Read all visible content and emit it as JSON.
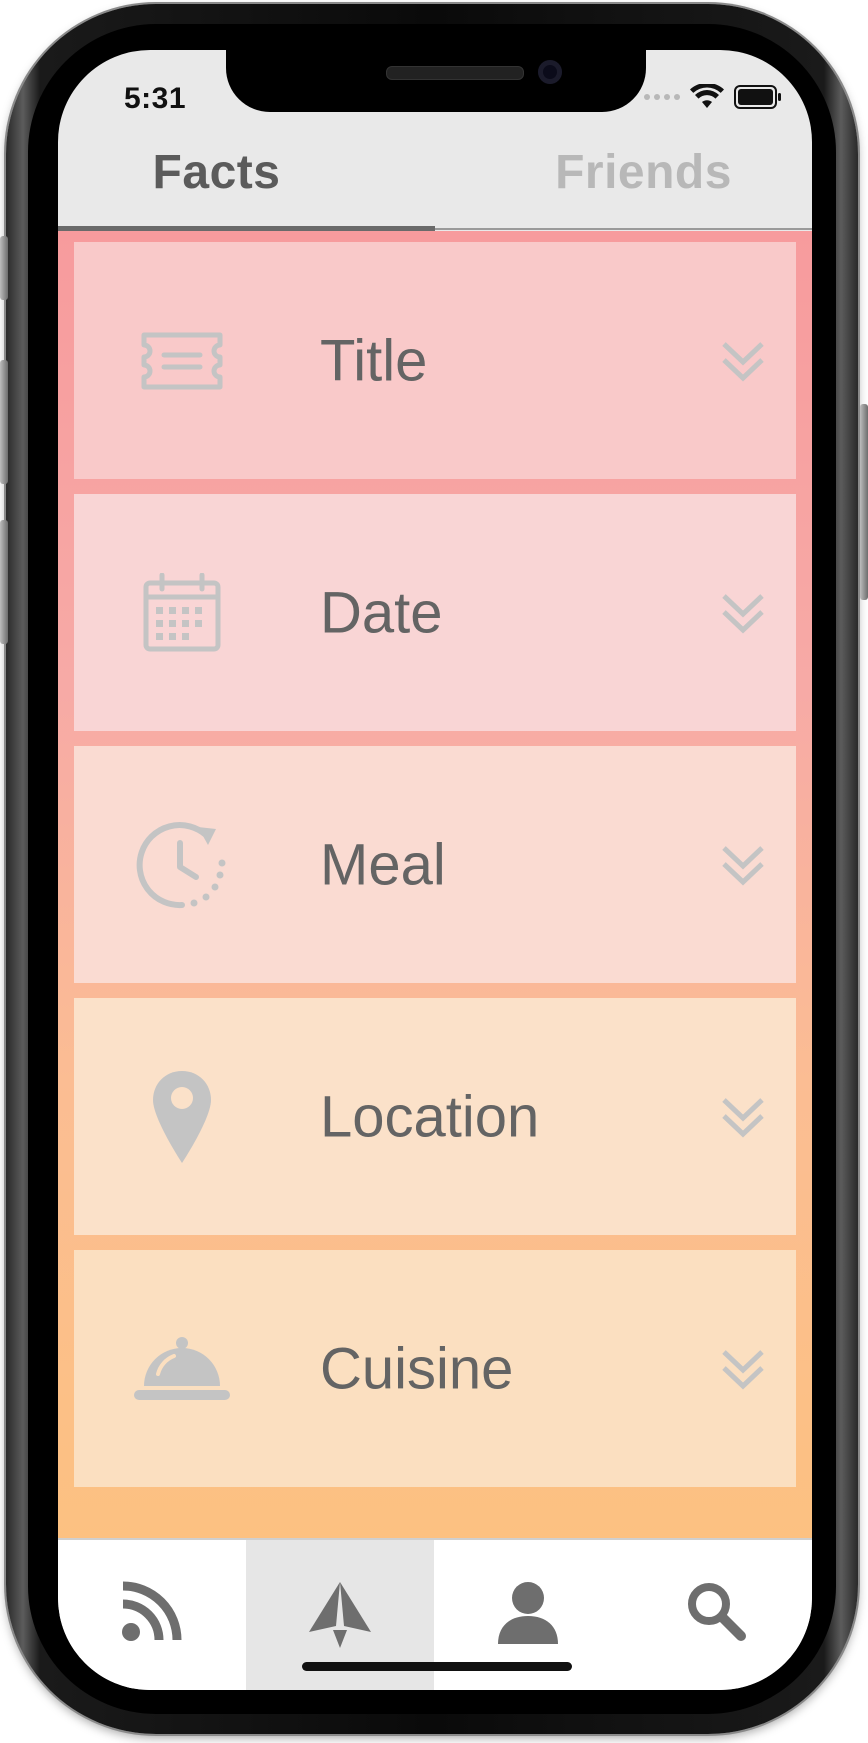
{
  "status_bar": {
    "time": "5:31"
  },
  "tabs": [
    {
      "label": "Facts",
      "active": true
    },
    {
      "label": "Friends",
      "active": false
    }
  ],
  "fact_items": [
    {
      "label": "Title",
      "icon": "ticket-icon",
      "bg": "#f9c9c9"
    },
    {
      "label": "Date",
      "icon": "calendar-icon",
      "bg": "#f9d5d5"
    },
    {
      "label": "Meal",
      "icon": "clock-icon",
      "bg": "#fadbd2"
    },
    {
      "label": "Location",
      "icon": "map-pin-icon",
      "bg": "#fbe1c9"
    },
    {
      "label": "Cuisine",
      "icon": "food-cloche-icon",
      "bg": "#fbdfc0"
    }
  ],
  "bottom_nav": [
    {
      "icon": "rss-feed-icon",
      "active": false
    },
    {
      "icon": "paper-plane-icon",
      "active": true
    },
    {
      "icon": "user-icon",
      "active": false
    },
    {
      "icon": "search-icon",
      "active": false
    }
  ],
  "colors": {
    "icon_gray": "#c4c4c4",
    "label_gray": "#646464",
    "nav_icon": "#6e6e6e"
  }
}
